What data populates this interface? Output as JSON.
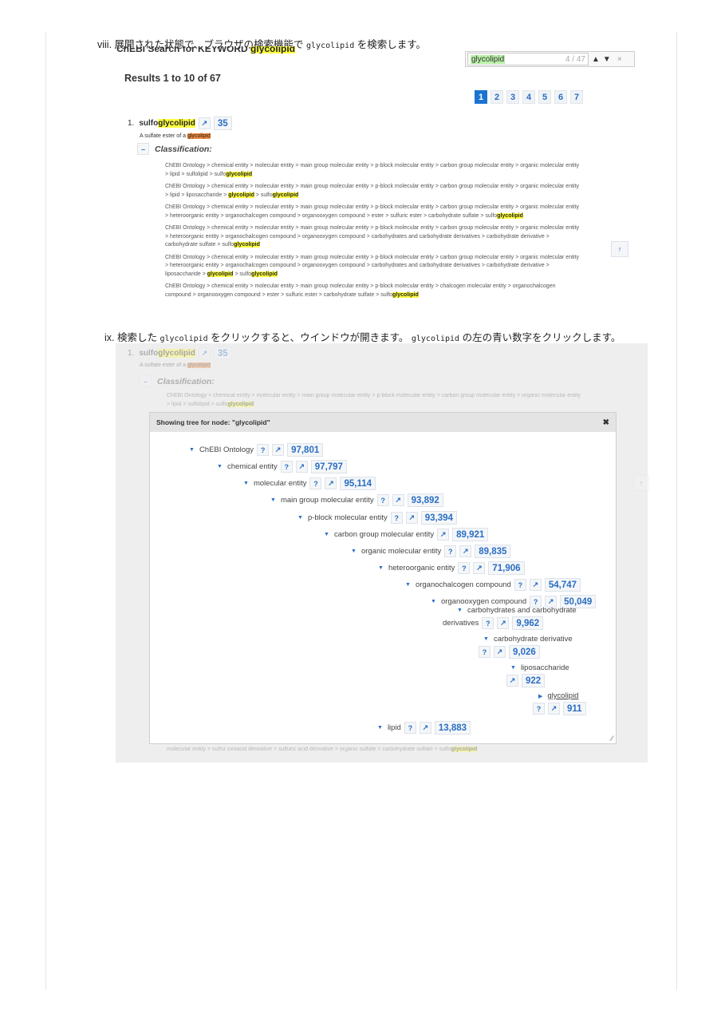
{
  "step8": {
    "prefix": "viii. 展開された状態で、ブラウザの検索機能で ",
    "code": "glycolipid",
    "suffix": " を検索します。"
  },
  "heading_partial": "ChEBI Search for KEYWORD ",
  "heading_keyword": "glycolipid",
  "find_bar": {
    "query": "glycolipid",
    "count": "4 / 47",
    "up": "▲",
    "down": "▼",
    "close": "×"
  },
  "results_label": "Results 1 to 10 of 67",
  "pages": [
    "1",
    "2",
    "3",
    "4",
    "5",
    "6",
    "7"
  ],
  "result": {
    "index": "1.",
    "name_prefix": "sulfo",
    "name_hl": "glycolipid",
    "arrow": "↗",
    "count": "35",
    "desc_prefix": "A sulfate ester of a ",
    "desc_hl": "glycolipid",
    "toggle": "–",
    "classification": "Classification:",
    "paths": [
      [
        "ChEBI Ontology > chemical entity > molecular entity > main group molecular entity > p-block molecular entity > carbon group molecular entity > organic molecular entity > lipid > sulfolipid > sulfo",
        "glycolipid"
      ],
      [
        "ChEBI Ontology > chemical entity > molecular entity > main group molecular entity > p-block molecular entity > carbon group molecular entity > organic molecular entity > lipid > liposaccharide > ",
        "glycolipid",
        " > sulfo",
        "glycolipid"
      ],
      [
        "ChEBI Ontology > chemical entity > molecular entity > main group molecular entity > p-block molecular entity > carbon group molecular entity > organic molecular entity > heteroorganic entity > organochalcogen compound > organooxygen compound > ester > sulfuric ester > carbohydrate sulfate > sulfo",
        "glycolipid"
      ],
      [
        "ChEBI Ontology > chemical entity > molecular entity > main group molecular entity > p-block molecular entity > carbon group molecular entity > organic molecular entity > heteroorganic entity > organochalcogen compound > organooxygen compound > carbohydrates and carbohydrate derivatives > carbohydrate derivative > carbohydrate sulfate > sulfo",
        "glycolipid"
      ],
      [
        "ChEBI Ontology > chemical entity > molecular entity > main group molecular entity > p-block molecular entity > carbon group molecular entity > organic molecular entity > heteroorganic entity > organochalcogen compound > organooxygen compound > carbohydrates and carbohydrate derivatives > carbohydrate derivative > liposaccharide > ",
        "glycolipid",
        " > sulfo",
        "glycolipid"
      ],
      [
        "ChEBI Ontology > chemical entity > molecular entity > main group molecular entity > p-block molecular entity > chalcogen molecular entity > organochalcogen compound > organooxygen compound > ester > sulfuric ester > carbohydrate sulfate > sulfo",
        "glycolipid"
      ]
    ]
  },
  "scroll_top": "↑",
  "step9": {
    "prefix": "ix. 検索した ",
    "code1": "glycolipid",
    "mid": " をクリックすると、ウインドウが開きます。 ",
    "code2": "glycolipid",
    "suffix": " の左の青い数字をクリックします。"
  },
  "faded_bottom": "molecular entity > sulfur oxoacid derivative > sulfuric acid derivative > organic sulfate > carbohydrate sulfate > sulfo",
  "dialog": {
    "title": "Showing tree for node: \"glycolipid\"",
    "close": "✖",
    "nodes": [
      {
        "label": "ChEBI Ontology",
        "q": "?",
        "arrow": "↗",
        "count": "97,801"
      },
      {
        "label": "chemical entity",
        "q": "?",
        "arrow": "↗",
        "count": "97,797"
      },
      {
        "label": "molecular entity",
        "q": "?",
        "arrow": "↗",
        "count": "95,114"
      },
      {
        "label": "main group molecular entity",
        "q": "?",
        "arrow": "↗",
        "count": "93,892"
      },
      {
        "label": "p-block molecular entity",
        "q": "?",
        "arrow": "↗",
        "count": "93,394"
      },
      {
        "label": "carbon group molecular entity",
        "arrow": "↗",
        "count": "89,921"
      },
      {
        "label": "organic molecular entity",
        "q": "?",
        "arrow": "↗",
        "count": "89,835"
      },
      {
        "label": "heteroorganic entity",
        "q": "?",
        "arrow": "↗",
        "count": "71,906"
      },
      {
        "label": "organochalcogen compound",
        "q": "?",
        "arrow": "↗",
        "count": "54,747"
      },
      {
        "label": "organooxygen compound",
        "q": "?",
        "arrow": "↗",
        "count": "50,049"
      },
      {
        "label": "carbohydrates and carbohydrate",
        "label2": "derivatives",
        "q": "?",
        "arrow": "↗",
        "count": "9,962"
      },
      {
        "label": "carbohydrate derivative",
        "q": "?",
        "arrow": "↗",
        "count": "9,026"
      },
      {
        "label": "liposaccharide",
        "arrow": "↗",
        "count": "922"
      },
      {
        "label": "glycolipid",
        "q": "?",
        "arrow": "↗",
        "count": "911"
      },
      {
        "label": "lipid",
        "q": "?",
        "arrow": "↗",
        "count": "13,883"
      }
    ]
  }
}
